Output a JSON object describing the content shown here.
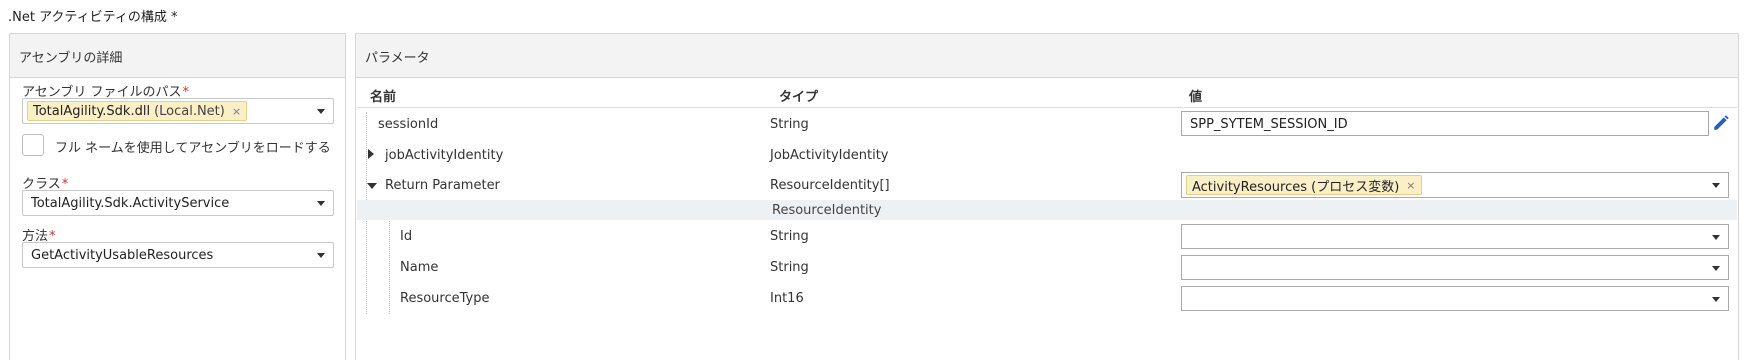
{
  "page": {
    "title": ".Net アクティビティの構成",
    "required_mark": "*"
  },
  "assembly_panel": {
    "header": "アセンブリの詳細",
    "file_path": {
      "label": "アセンブリ ファイルのパス",
      "required": "*",
      "tag_value": "TotalAgility.Sdk.dll",
      "tag_suffix": "(Local.Net)",
      "tag_remove": "×"
    },
    "full_name_checkbox": {
      "label": "フル ネームを使用してアセンブリをロードする",
      "checked": false
    },
    "class_field": {
      "label": "クラス",
      "required": "*",
      "value": "TotalAgility.Sdk.ActivityService"
    },
    "method_field": {
      "label": "方法",
      "required": "*",
      "value": "GetActivityUsableResources"
    }
  },
  "parameters_panel": {
    "header": "パラメータ",
    "columns": {
      "name": "名前",
      "type": "タイプ",
      "value": "値"
    },
    "rows": [
      {
        "name": "sessionId",
        "type": "String",
        "value": "SPP_SYTEM_SESSION_ID"
      },
      {
        "name": "jobActivityIdentity",
        "type": "JobActivityIdentity",
        "expanded": false
      },
      {
        "name": "Return Parameter",
        "type": "ResourceIdentity[]",
        "value_tag": "ActivityResources (プロセス変数)",
        "value_tag_remove": "×",
        "expanded": true
      }
    ],
    "sub_header": "ResourceIdentity",
    "sub_rows": [
      {
        "name": "Id",
        "type": "String",
        "value": ""
      },
      {
        "name": "Name",
        "type": "String",
        "value": ""
      },
      {
        "name": "ResourceType",
        "type": "Int16",
        "value": ""
      }
    ],
    "icons": {
      "edit": "pencil-icon",
      "expand": "caret-right-icon",
      "collapse": "caret-down-icon",
      "dropdown": "chevron-down-icon"
    },
    "colors": {
      "tag_bg": "#fbefc7",
      "edit_icon": "#2b5fb3",
      "required": "#c0392b"
    }
  }
}
